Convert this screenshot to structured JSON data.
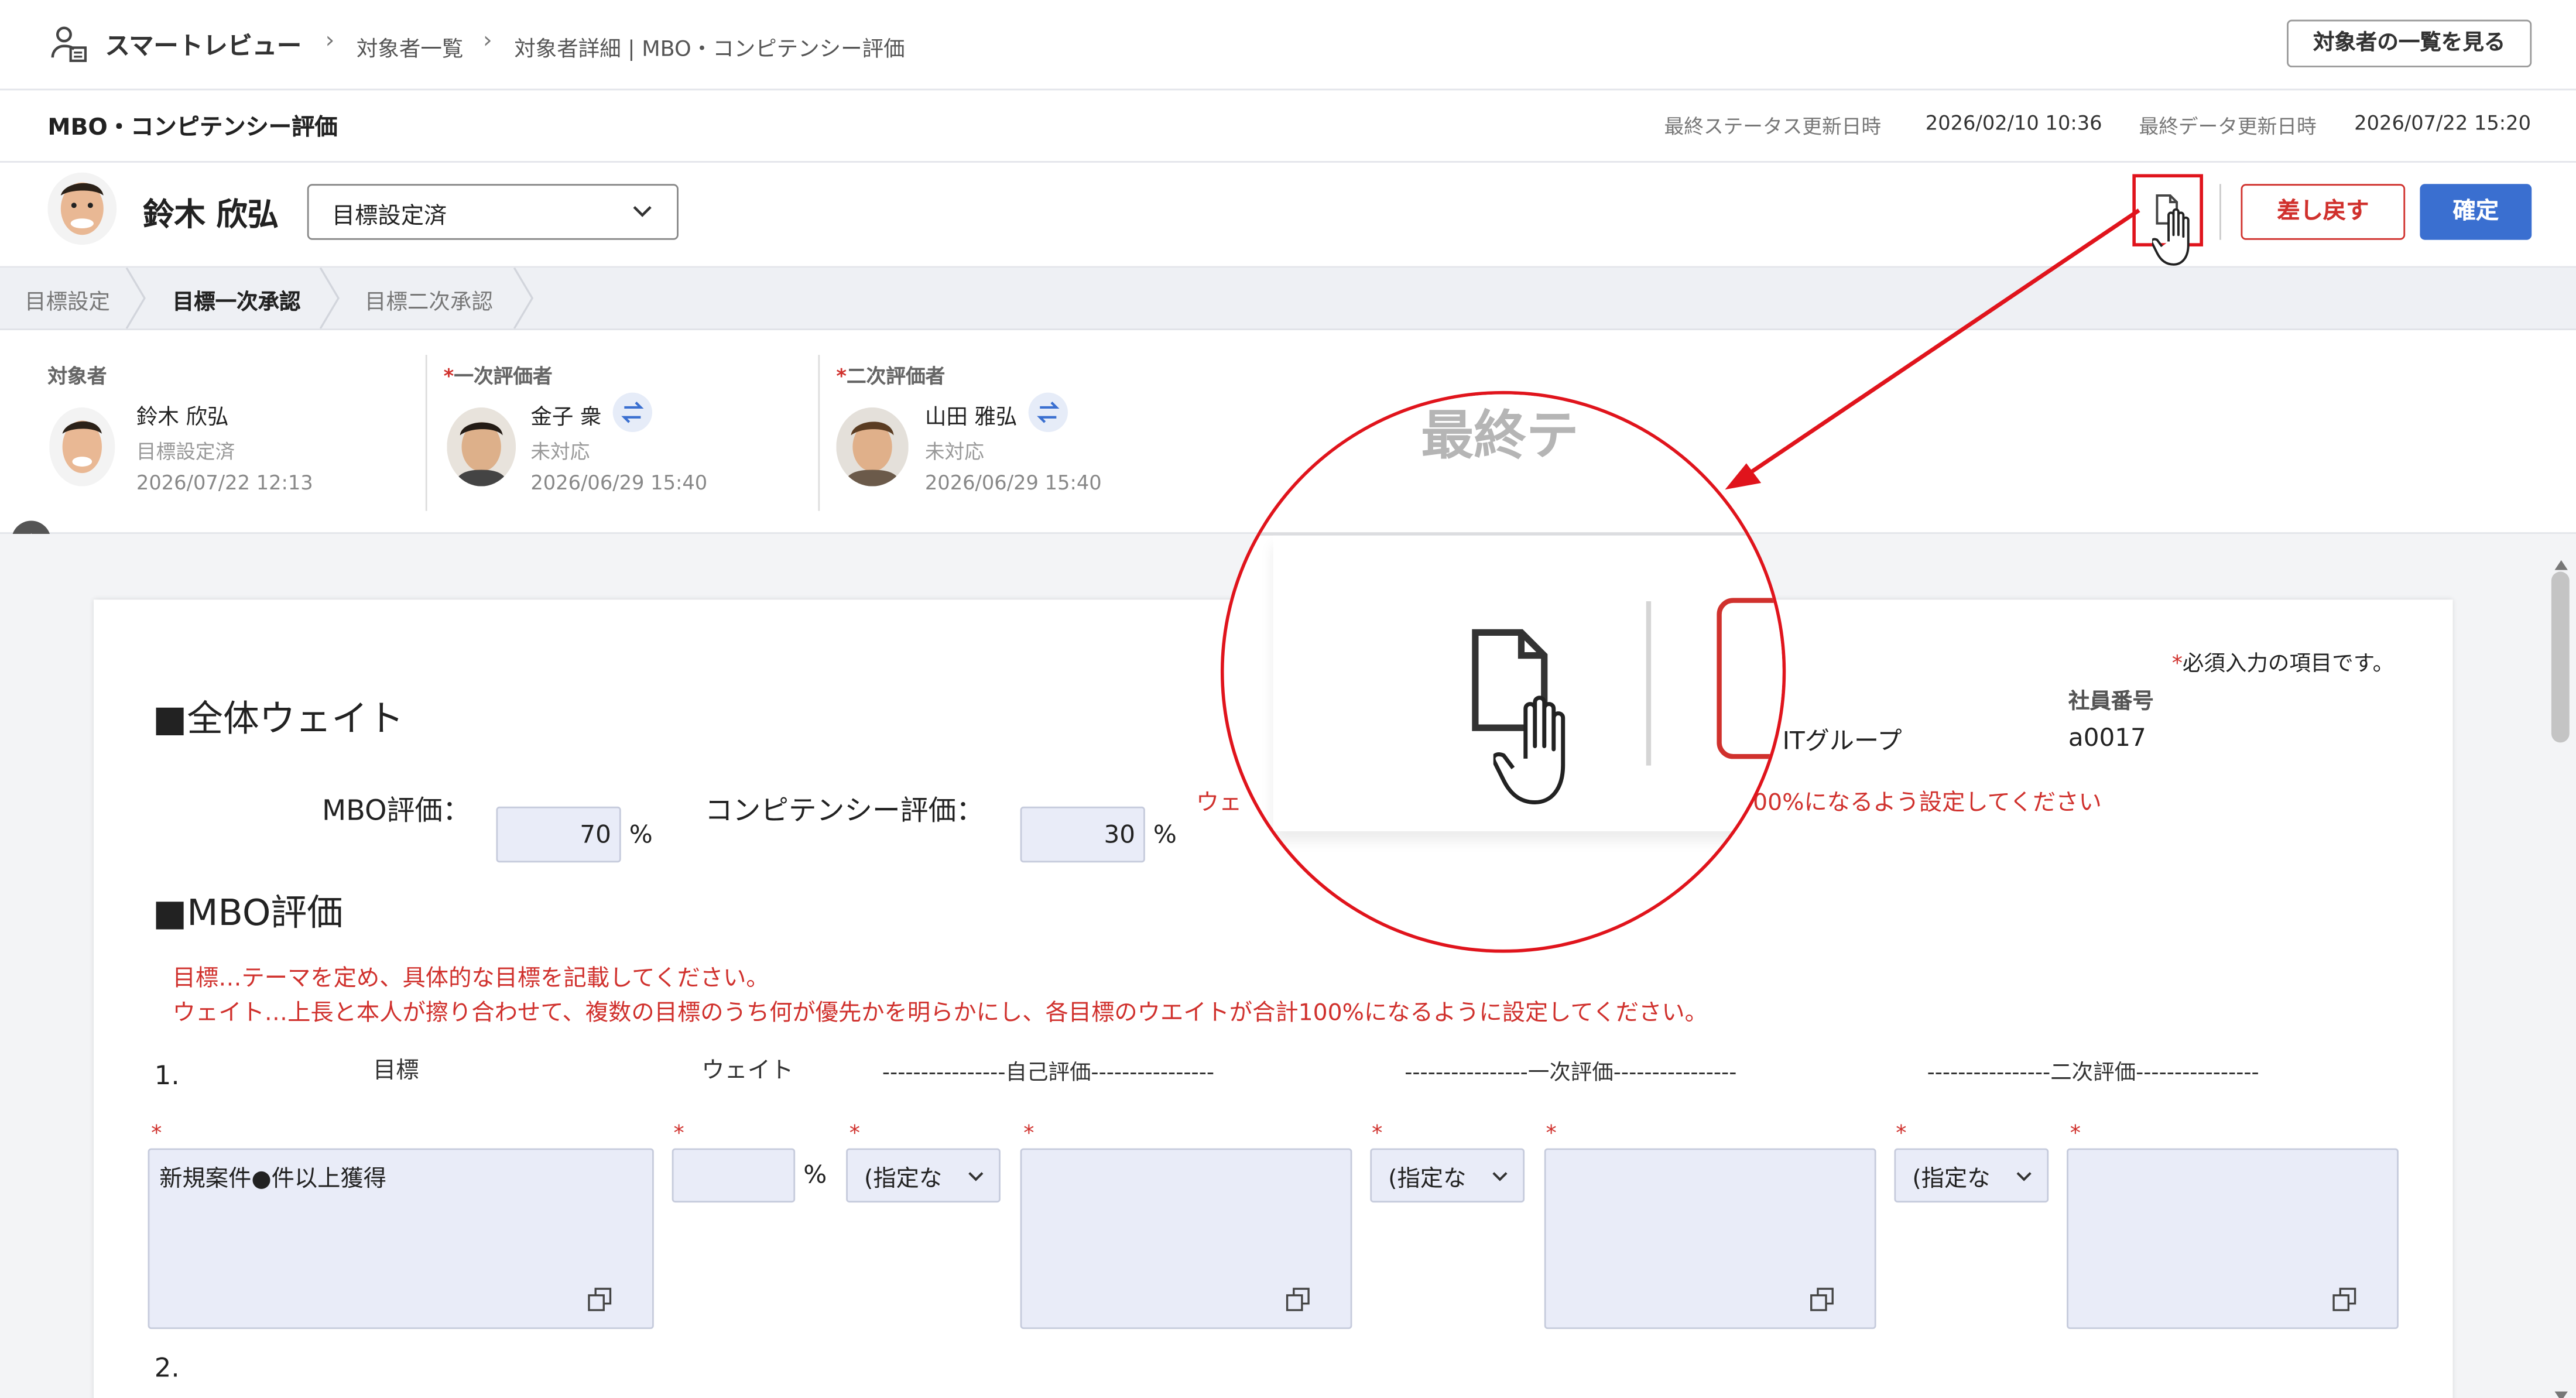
{
  "breadcrumb": {
    "app_title": "スマートレビュー",
    "items": [
      "対象者一覧",
      "対象者詳細 | MBO・コンピテンシー評価"
    ]
  },
  "header": {
    "list_button": "対象者の一覧を見る",
    "page_title": "MBO・コンピテンシー評価",
    "status_updated_label": "最終ステータス更新日時",
    "status_updated_value": "2026/02/10 10:36",
    "data_updated_label": "最終データ更新日時",
    "data_updated_value": "2026/07/22 15:20"
  },
  "subject": {
    "name": "鈴木 欣弘",
    "status_select": "目標設定済",
    "return_button": "差し戻す",
    "confirm_button": "確定"
  },
  "steps": [
    {
      "label": "目標設定",
      "active": false
    },
    {
      "label": "目標一次承認",
      "active": true
    },
    {
      "label": "目標二次承認",
      "active": false
    }
  ],
  "evaluators": [
    {
      "role": "対象者",
      "required": false,
      "name": "鈴木 欣弘",
      "status": "目標設定済",
      "date": "2026/07/22 12:13"
    },
    {
      "role": "一次評価者",
      "required": true,
      "name": "金子 衆",
      "status": "未対応",
      "date": "2026/06/29 15:40"
    },
    {
      "role": "二次評価者",
      "required": true,
      "name": "山田 雅弘",
      "status": "未対応",
      "date": "2026/06/29 15:40"
    }
  ],
  "form": {
    "required_note": "必須入力の項目です。",
    "employee_no_label": "社員番号",
    "employee_no": "a0017",
    "group": "ITグループ",
    "overall_weight_heading": "■全体ウェイト",
    "mbo_label": "MBO評価：",
    "mbo_weight": "70",
    "competency_label": "コンピテンシー評価：",
    "competency_weight": "30",
    "percent": "%",
    "weight_warning_prefix": "ウェ",
    "weight_warning_suffix": "00%になるよう設定してください",
    "mbo_heading": "■MBO評価",
    "instruction1": "目標…テーマを定め、具体的な目標を記載してください。",
    "instruction2": "ウェイト…上長と本人が擦り合わせて、複数の目標のうち何が優先かを明らかにし、各目標のウエイトが合計100%になるように設定してください。",
    "item1_no": "1.",
    "item2_no": "2.",
    "col_goal": "目標",
    "col_weight": "ウェイト",
    "col_self": "----------------自己評価----------------",
    "col_first": "----------------一次評価----------------",
    "col_second": "----------------二次評価----------------",
    "goal_text": "新規案件●件以上獲得",
    "weight_value": "",
    "self_select": "(指定な",
    "first_select": "(指定な",
    "second_select": "(指定な"
  },
  "zoom": {
    "text_fragment": "最終テ"
  },
  "colors": {
    "accent_blue": "#3a6fd0",
    "alert_red": "#d0312d",
    "input_bg": "#e9ecf8",
    "callout_red": "#e0141c"
  }
}
